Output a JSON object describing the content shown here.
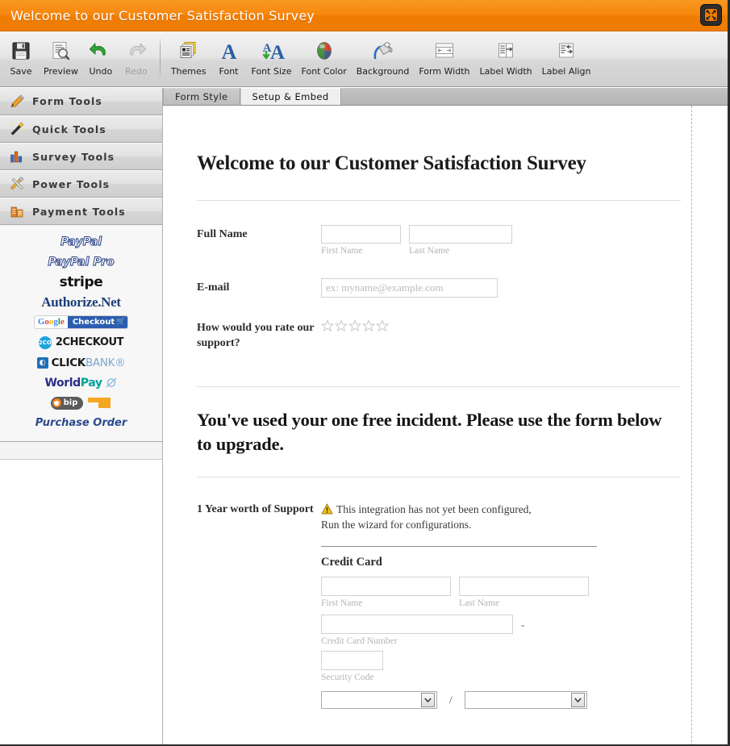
{
  "window": {
    "title": "Welcome to our Customer Satisfaction Survey",
    "maximize_icon": "expand-arrows-icon",
    "header_color": "#f3870d"
  },
  "toolbar": {
    "groups": [
      {
        "items": [
          {
            "label": "Save",
            "icon": "floppy-disk-icon",
            "disabled": false
          },
          {
            "label": "Preview",
            "icon": "magnifier-page-icon",
            "disabled": false
          },
          {
            "label": "Undo",
            "icon": "undo-arrow-icon",
            "disabled": false
          },
          {
            "label": "Redo",
            "icon": "redo-arrow-icon",
            "disabled": true
          }
        ]
      },
      {
        "items": [
          {
            "label": "Themes",
            "icon": "themes-stack-icon",
            "disabled": false
          },
          {
            "label": "Font",
            "icon": "letter-a-icon",
            "disabled": false
          },
          {
            "label": "Font Size",
            "icon": "letter-aa-arrow-icon",
            "disabled": false
          },
          {
            "label": "Font Color",
            "icon": "color-sphere-icon",
            "disabled": false
          },
          {
            "label": "Background",
            "icon": "paint-bucket-icon",
            "disabled": false
          },
          {
            "label": "Form Width",
            "icon": "form-width-icon",
            "disabled": false
          },
          {
            "label": "Label Width",
            "icon": "label-width-icon",
            "disabled": false
          },
          {
            "label": "Label Align",
            "icon": "label-align-icon",
            "disabled": false
          }
        ]
      }
    ]
  },
  "sidebar": {
    "sections": [
      {
        "label": "Form Tools",
        "icon": "pencil-icon"
      },
      {
        "label": "Quick Tools",
        "icon": "magic-wand-icon"
      },
      {
        "label": "Survey Tools",
        "icon": "bar-chart-icon"
      },
      {
        "label": "Power Tools",
        "icon": "crossed-tools-icon"
      },
      {
        "label": "Payment Tools",
        "icon": "payment-stack-icon",
        "expanded": true
      }
    ],
    "payment_items": [
      {
        "name": "PayPal",
        "id": "paypal"
      },
      {
        "name": "PayPal Pro",
        "id": "paypal-pro"
      },
      {
        "name": "stripe",
        "id": "stripe"
      },
      {
        "name": "Authorize.Net",
        "id": "authorize-net"
      },
      {
        "name": "Google Checkout",
        "id": "google-checkout"
      },
      {
        "name": "2CHECKOUT",
        "id": "2checkout"
      },
      {
        "name": "CLICKBANK",
        "id": "clickbank"
      },
      {
        "name": "WorldPay",
        "id": "worldpay"
      },
      {
        "name": "bip",
        "id": "bip"
      },
      {
        "name": "Purchase Order",
        "id": "purchase-order"
      }
    ]
  },
  "tabs": [
    {
      "label": "Form Style",
      "active": false
    },
    {
      "label": "Setup & Embed",
      "active": true
    }
  ],
  "form": {
    "heading": "Welcome to our Customer Satisfaction Survey",
    "fields": [
      {
        "label": "Full Name",
        "type": "name",
        "first": {
          "value": "",
          "sublabel": "First Name"
        },
        "last": {
          "value": "",
          "sublabel": "Last Name"
        }
      },
      {
        "label": "E-mail",
        "type": "email",
        "placeholder": "ex: myname@example.com",
        "value": ""
      },
      {
        "label": "How would you rate our support?",
        "type": "rating",
        "stars_total": 5,
        "stars_filled": 0
      }
    ],
    "section_heading": "You've used your one free incident. Please use the form below to upgrade.",
    "payment": {
      "label": "1 Year worth of Support",
      "warning_icon": "warning-triangle-icon",
      "warning_line1": "This integration has not yet been configured,",
      "warning_line2": "Run the wizard for configurations.",
      "card_heading": "Credit Card",
      "first_name": {
        "value": "",
        "sublabel": "First Name"
      },
      "last_name": {
        "value": "",
        "sublabel": "Last Name"
      },
      "card_number": {
        "value": "",
        "sublabel": "Credit Card Number",
        "separator": "-"
      },
      "security_code": {
        "value": "",
        "sublabel": "Security Code"
      },
      "expiry": {
        "month": "",
        "year": "",
        "separator": "/"
      }
    }
  }
}
